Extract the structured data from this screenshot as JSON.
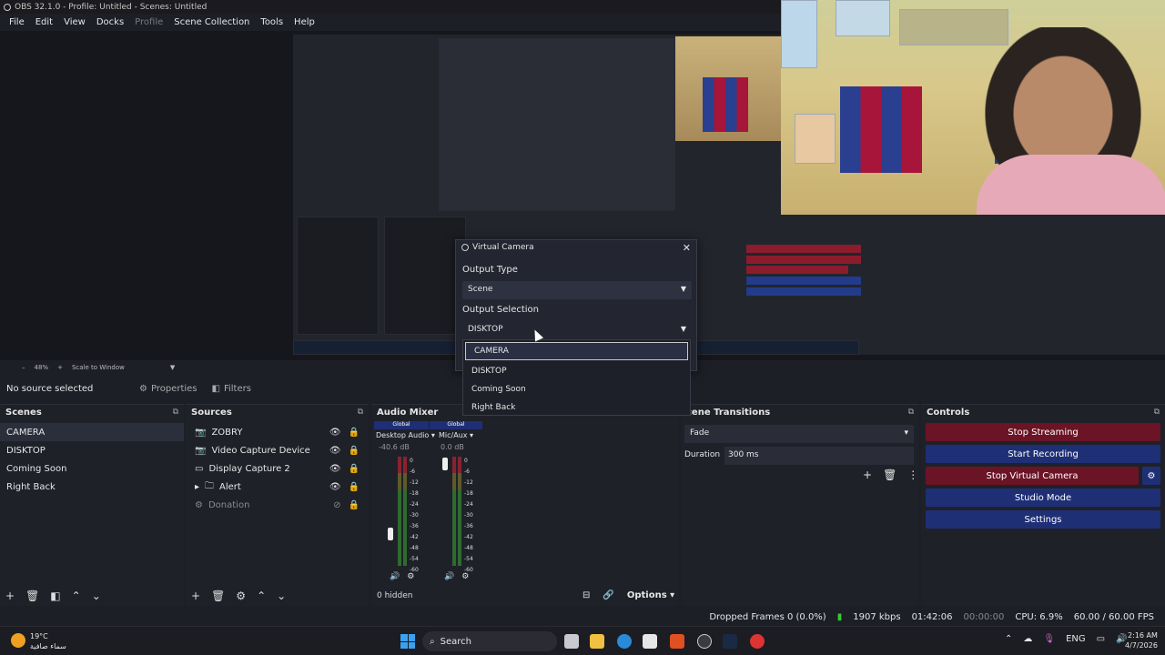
{
  "window": {
    "title": "OBS 32.1.0 - Profile: Untitled - Scenes: Untitled"
  },
  "menu": [
    "File",
    "Edit",
    "View",
    "Docks",
    "Profile",
    "Scene Collection",
    "Tools",
    "Help"
  ],
  "preview_bar": {
    "zoom": "48%",
    "scale": "Scale to Window"
  },
  "source_toolbar": {
    "selected": "No source selected",
    "properties": "Properties",
    "filters": "Filters"
  },
  "scenes": {
    "title": "Scenes",
    "items": [
      "CAMERA",
      "DISKTOP",
      "Coming Soon",
      "Right Back"
    ],
    "selected": 0
  },
  "sources": {
    "title": "Sources",
    "items": [
      {
        "name": "ZOBRY",
        "icon": "camera-icon"
      },
      {
        "name": "Video Capture Device",
        "icon": "camera-icon"
      },
      {
        "name": "Display Capture 2",
        "icon": "monitor-icon"
      },
      {
        "name": "Alert",
        "icon": "folder-icon"
      },
      {
        "name": "Donation",
        "icon": "gear-icon"
      }
    ]
  },
  "audio_mixer": {
    "title": "Audio Mixer",
    "hidden": "0 hidden",
    "channels": [
      {
        "badge": "Global",
        "name": "Desktop Audio",
        "db": "-40.6 dB"
      },
      {
        "badge": "Global",
        "name": "Mic/Aux",
        "db": "0.0 dB"
      }
    ],
    "scale": [
      "0",
      "-6",
      "-12",
      "-18",
      "-24",
      "-30",
      "-36",
      "-42",
      "-48",
      "-54",
      "-60"
    ],
    "options": "Options"
  },
  "transitions": {
    "title": "cene Transitions",
    "type": "Fade",
    "duration_label": "Duration",
    "duration": "300 ms"
  },
  "controls": {
    "title": "Controls",
    "buttons": [
      {
        "label": "Stop Streaming",
        "color": "#6b1426"
      },
      {
        "label": "Start Recording",
        "color": "#1f2f76"
      },
      {
        "label": "Stop Virtual Camera",
        "color": "#6b1426"
      },
      {
        "label": "Studio Mode",
        "color": "#1f2f76"
      },
      {
        "label": "Settings",
        "color": "#1f2f76"
      }
    ]
  },
  "virtual_camera_dialog": {
    "title": "Virtual Camera",
    "output_type_label": "Output Type",
    "output_type": "Scene",
    "output_selection_label": "Output Selection",
    "output_selection": "DISKTOP",
    "options": [
      "CAMERA",
      "DISKTOP",
      "Coming Soon",
      "Right Back"
    ],
    "highlighted": 0
  },
  "status": {
    "dropped": "Dropped Frames 0 (0.0%)",
    "kbps": "1907 kbps",
    "live_time": "01:42:06",
    "rec_time": "00:00:00",
    "cpu": "CPU: 6.9%",
    "fps": "60.00 / 60.00 FPS"
  },
  "taskbar": {
    "weather_temp": "19°C",
    "weather_desc": "سماء صافية",
    "search": "Search",
    "lang": "ENG",
    "time": "2:16 AM",
    "date": "4/7/2026"
  }
}
